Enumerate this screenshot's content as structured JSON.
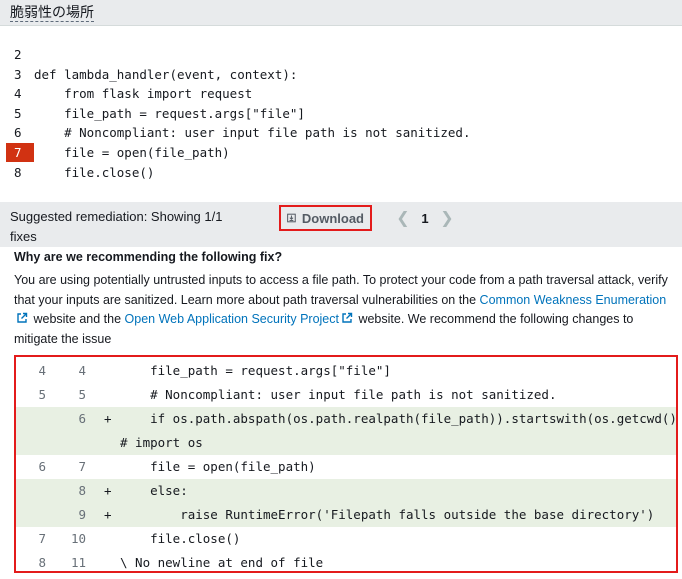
{
  "header": {
    "title": "脆弱性の場所"
  },
  "code": {
    "lines": [
      {
        "no": "2",
        "text": ""
      },
      {
        "no": "3",
        "text": "def lambda_handler(event, context):"
      },
      {
        "no": "4",
        "text": "    from flask import request"
      },
      {
        "no": "5",
        "text": "    file_path = request.args[\"file\"]"
      },
      {
        "no": "6",
        "text": "    # Noncompliant: user input file path is not sanitized."
      },
      {
        "no": "7",
        "text": "    file = open(file_path)"
      },
      {
        "no": "8",
        "text": "    file.close()"
      }
    ],
    "highlight_line": "7"
  },
  "remediation": {
    "text": "Suggested remediation: Showing 1/1 fixes",
    "download_label": "Download",
    "page": "1"
  },
  "explanation": {
    "heading": "Why are we recommending the following fix?",
    "p1": "You are using potentially untrusted inputs to access a file path. To protect your code from a path traversal attack, verify that your inputs are sanitized. Learn more about path traversal vulnerabilities on the ",
    "link1": "Common Weakness Enumeration",
    "p2": " website and the ",
    "link2": "Open Web Application Security Project",
    "p3": " website. We recommend the following changes to mitigate the issue"
  },
  "diff": {
    "rows": [
      {
        "old": "4",
        "new": "4",
        "mark": "",
        "code": "    file_path = request.args[\"file\"]",
        "added": false
      },
      {
        "old": "5",
        "new": "5",
        "mark": "",
        "code": "    # Noncompliant: user input file path is not sanitized.",
        "added": false
      },
      {
        "old": "",
        "new": "6",
        "mark": "+",
        "code": "    if os.path.abspath(os.path.realpath(file_path)).startswith(os.getcwd()):",
        "added": true
      },
      {
        "old": "",
        "new": "",
        "mark": "",
        "code": "# import os",
        "added": true
      },
      {
        "old": "6",
        "new": "7",
        "mark": "",
        "code": "    file = open(file_path)",
        "added": false
      },
      {
        "old": "",
        "new": "8",
        "mark": "+",
        "code": "    else:",
        "added": true
      },
      {
        "old": "",
        "new": "9",
        "mark": "+",
        "code": "        raise RuntimeError('Filepath falls outside the base directory')",
        "added": true
      },
      {
        "old": "7",
        "new": "10",
        "mark": "",
        "code": "    file.close()",
        "added": false
      },
      {
        "old": "8",
        "new": "11",
        "mark": "",
        "code": "\\ No newline at end of file",
        "added": false
      }
    ]
  },
  "colors": {
    "highlight": "#d13212",
    "link": "#0073bb",
    "added_bg": "#e8f0e3",
    "annotation_border": "#e31b1b"
  }
}
